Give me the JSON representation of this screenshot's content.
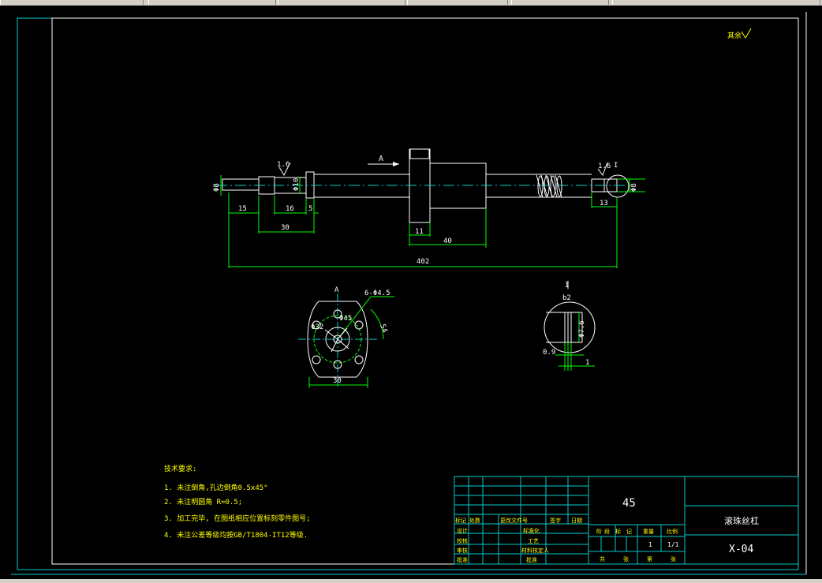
{
  "window": {
    "toolbar_segments": [
      "",
      "",
      "",
      "",
      "",
      ""
    ]
  },
  "drawing": {
    "corner_mark": "其余",
    "dims": {
      "d8_left": "Φ8",
      "d10": "Φ10",
      "d8_right": "Φ8",
      "rough_left": "1.6",
      "rough_right": "1.6",
      "len15": "15",
      "len16": "16",
      "len5": "5",
      "len30": "30",
      "len11": "11",
      "len40": "40",
      "len402": "402",
      "len13": "13",
      "sectionA": "A",
      "sectionA_arrow": "A",
      "detailI": "I",
      "detailI_label": "I",
      "holes": "6-Φ4.5",
      "d32": "Φ32",
      "d45": "Φ45",
      "d54": "54",
      "flange30": "30",
      "b2": "b2",
      "d76": "Φ7.6",
      "gap09": "0.9",
      "gap1": "1"
    },
    "notes": {
      "title": "技术要求:",
      "items": [
        "1. 未注倒角,孔边倒角0.5x45°",
        "2. 未注明圆角 R=0.5;",
        "3. 加工完毕, 在图纸相应位置标刻零件图号;",
        "4. 未注公差等级均按GB/T1804-IT12等级."
      ]
    },
    "title_block": {
      "material": "45",
      "part_name": "滚珠丝杠",
      "drawing_no": "X-04",
      "row_headers": [
        "标记",
        "处数",
        "更改文件号",
        "签字",
        "日期"
      ],
      "left_labels": [
        "设计",
        "校核",
        "审核",
        "批准"
      ],
      "mid_labels": [
        "标准化",
        "工艺",
        "材料核定人",
        "批准"
      ],
      "stage_headers": [
        "阶",
        "段",
        "标",
        "记",
        "重量",
        "比例"
      ],
      "weight": "1",
      "scale": "1/1",
      "sheet_labels": [
        "共",
        "张",
        "第",
        "张"
      ]
    }
  }
}
